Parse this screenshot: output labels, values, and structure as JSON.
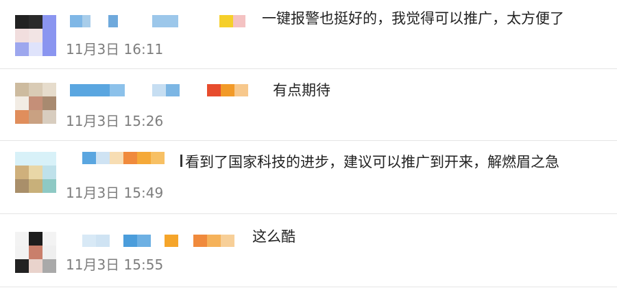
{
  "comments": [
    {
      "text": "一键报警也挺好的，我觉得可以推广，太方便了",
      "time": "11月3日 16:11"
    },
    {
      "text": "有点期待",
      "time": "11月3日 15:26"
    },
    {
      "text": "看到了国家科技的进步，建议可以推广到开来，解燃眉之急",
      "time": "11月3日 15:49"
    },
    {
      "text": "这么酷",
      "time": "11月3日 15:55"
    }
  ]
}
